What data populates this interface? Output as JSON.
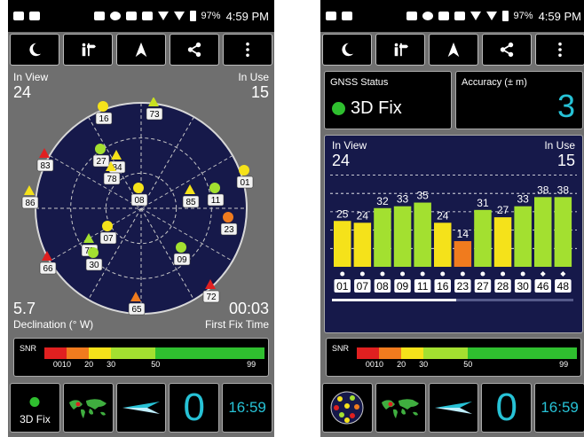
{
  "status_bar": {
    "battery": "97%",
    "time": "4:59 PM"
  },
  "toolbar": {
    "icons": [
      "moon-icon",
      "signpost-icon",
      "navigation-arrow-icon",
      "share-icon",
      "overflow-menu-icon"
    ]
  },
  "sky": {
    "in_view_label": "In View",
    "in_view_value": "24",
    "in_use_label": "In Use",
    "in_use_value": "15",
    "declination_value": "5.7",
    "declination_label": "Declination (° W)",
    "first_fix_value": "00:03",
    "first_fix_label": "First Fix Time",
    "satellites": [
      {
        "id": "16",
        "shape": "circle",
        "color": "#f5e21a"
      },
      {
        "id": "73",
        "shape": "triangle",
        "color": "#c8e020"
      },
      {
        "id": "27",
        "shape": "circle",
        "color": "#a3e030"
      },
      {
        "id": "84",
        "shape": "triangle",
        "color": "#f5e21a"
      },
      {
        "id": "78",
        "shape": "triangle",
        "color": "#f5e21a"
      },
      {
        "id": "83",
        "shape": "triangle",
        "color": "#e02020"
      },
      {
        "id": "01",
        "shape": "circle",
        "color": "#f5e21a"
      },
      {
        "id": "08",
        "shape": "circle",
        "color": "#f5e21a"
      },
      {
        "id": "85",
        "shape": "triangle",
        "color": "#f5e21a"
      },
      {
        "id": "11",
        "shape": "circle",
        "color": "#a3e030"
      },
      {
        "id": "86",
        "shape": "triangle",
        "color": "#f5e21a"
      },
      {
        "id": "23",
        "shape": "circle",
        "color": "#f07b1e"
      },
      {
        "id": "07",
        "shape": "circle",
        "color": "#f5e21a"
      },
      {
        "id": "75",
        "shape": "triangle",
        "color": "#a3e030"
      },
      {
        "id": "30",
        "shape": "circle",
        "color": "#a3e030"
      },
      {
        "id": "66",
        "shape": "triangle",
        "color": "#e02020"
      },
      {
        "id": "09",
        "shape": "circle",
        "color": "#a3e030"
      },
      {
        "id": "72",
        "shape": "triangle",
        "color": "#e02020"
      },
      {
        "id": "65",
        "shape": "triangle",
        "color": "#f07b1e"
      }
    ]
  },
  "snr": {
    "title": "SNR",
    "ticks": [
      "00",
      "10",
      "20",
      "30",
      "50",
      "99"
    ],
    "segments": [
      {
        "color": "#e02020",
        "weight": 10
      },
      {
        "color": "#f07b1e",
        "weight": 10
      },
      {
        "color": "#f5e21a",
        "weight": 10
      },
      {
        "color": "#a3e030",
        "weight": 20
      },
      {
        "color": "#2fbf2f",
        "weight": 49
      }
    ]
  },
  "left_bottom": {
    "fix_label": "3D Fix",
    "big_number": "0",
    "time": "16:59"
  },
  "right": {
    "gnss_status_title": "GNSS Status",
    "gnss_status_value": "3D Fix",
    "accuracy_title": "Accuracy (± m)",
    "accuracy_value": "3",
    "in_view_label": "In View",
    "in_view_value": "24",
    "in_use_label": "In Use",
    "in_use_value": "15",
    "big_number": "0",
    "time": "16:59"
  },
  "chart_data": {
    "type": "bar",
    "categories": [
      "01",
      "07",
      "08",
      "09",
      "11",
      "16",
      "23",
      "27",
      "28",
      "30",
      "46",
      "48"
    ],
    "values": [
      25,
      24,
      32,
      33,
      35,
      24,
      14,
      31,
      27,
      33,
      38,
      38
    ],
    "colors": [
      "#f5e21a",
      "#f5e21a",
      "#a3e030",
      "#a3e030",
      "#a3e030",
      "#f5e21a",
      "#f07b1e",
      "#a3e030",
      "#f5e21a",
      "#a3e030",
      "#a3e030",
      "#a3e030"
    ],
    "markers": [
      "dot",
      "dot",
      "dot",
      "dot",
      "dot",
      "dot",
      "dot",
      "dot",
      "dot",
      "dot",
      "diamond",
      "diamond"
    ],
    "ylim": [
      0,
      50
    ]
  }
}
